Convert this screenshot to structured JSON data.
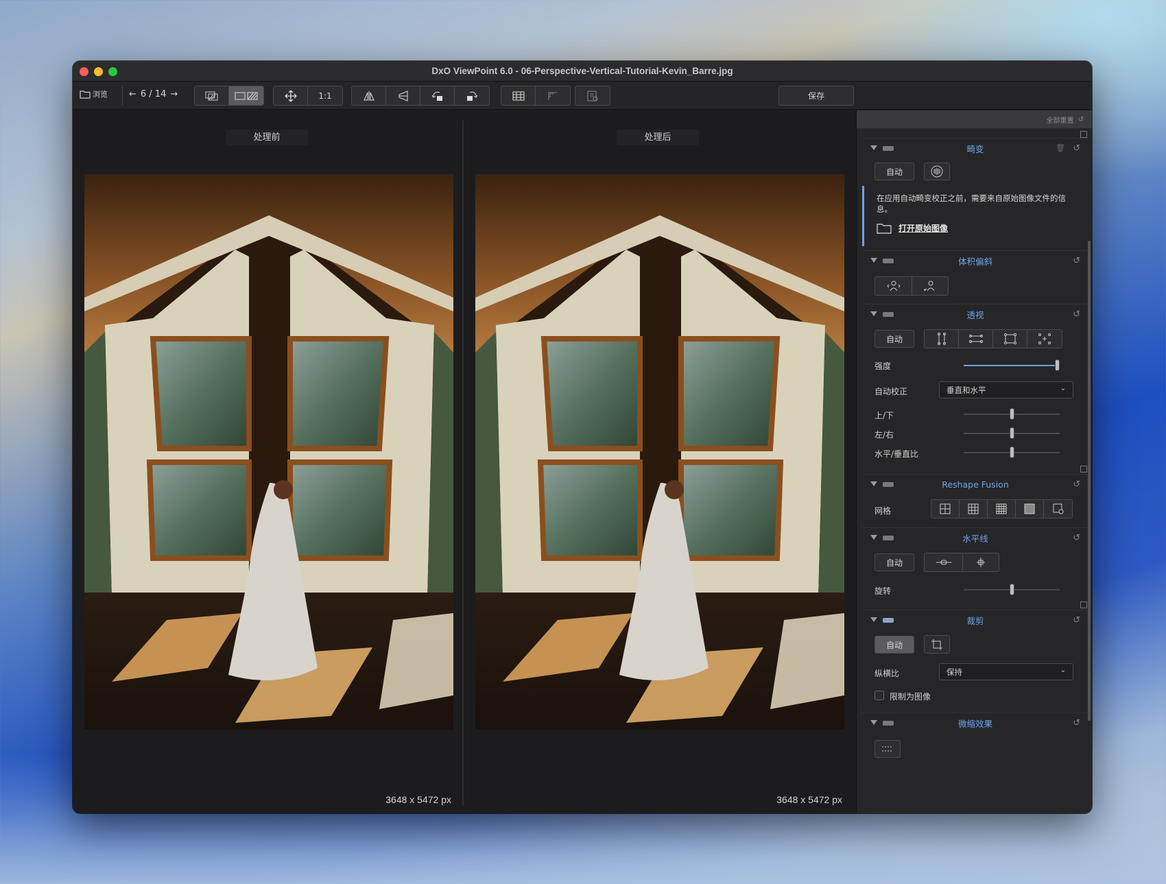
{
  "window": {
    "title": "DxO ViewPoint 6.0 - 06-Perspective-Vertical-Tutorial-Kevin_Barre.jpg"
  },
  "toolbar": {
    "browse_label": "浏览",
    "nav_prev": "←",
    "nav_counter": "6 / 14",
    "nav_next": "→",
    "zoom_label": "1:1",
    "save_label": "保存"
  },
  "viewer": {
    "before_label": "处理前",
    "after_label": "处理后",
    "before_dims": "3648 x 5472 px",
    "after_dims": "3648 x 5472 px"
  },
  "sidebar": {
    "reset_all": "全部重置",
    "distortion": {
      "title": "畸变",
      "auto_button": "自动",
      "info_text": "在应用自动畸变校正之前，需要来自原始图像文件的信息。",
      "open_original": "打开原始图像"
    },
    "volume": {
      "title": "体积偏斜"
    },
    "perspective": {
      "title": "透视",
      "auto_button": "自动",
      "intensity_label": "强度",
      "intensity_value": 1.0,
      "auto_correct_label": "自动校正",
      "auto_correct_value": "垂直和水平",
      "updown_label": "上/下",
      "updown_value": 0.5,
      "leftright_label": "左/右",
      "leftright_value": 0.5,
      "ratio_label": "水平/垂直比",
      "ratio_value": 0.5
    },
    "reshape": {
      "title": "Reshape Fusion",
      "grid_label": "网格"
    },
    "horizon": {
      "title": "水平线",
      "auto_button": "自动",
      "rotate_label": "旋转",
      "rotate_value": 0.5
    },
    "crop": {
      "title": "裁剪",
      "auto_button": "自动",
      "aspect_label": "纵横比",
      "aspect_value": "保持",
      "constrain_label": "限制为图像",
      "constrain_checked": false
    },
    "miniature": {
      "title": "微缩效果"
    }
  },
  "colors": {
    "accent": "#6fa4e8",
    "window_bg": "#1c1c1e",
    "panel_bg": "#262628"
  }
}
